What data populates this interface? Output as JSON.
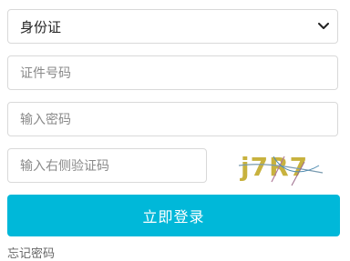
{
  "id_type_select": {
    "selected": "身份证"
  },
  "id_number_input": {
    "placeholder": "证件号码"
  },
  "password_input": {
    "placeholder": "输入密码"
  },
  "captcha_input": {
    "placeholder": "输入右侧验证码"
  },
  "captcha_image": {
    "text": "j7R7"
  },
  "login_button": {
    "label": "立即登录",
    "color": "#00b8d9"
  },
  "forgot_password_link": {
    "label": "忘记密码"
  },
  "icons": {
    "select_arrow": "chevron-down-icon"
  }
}
